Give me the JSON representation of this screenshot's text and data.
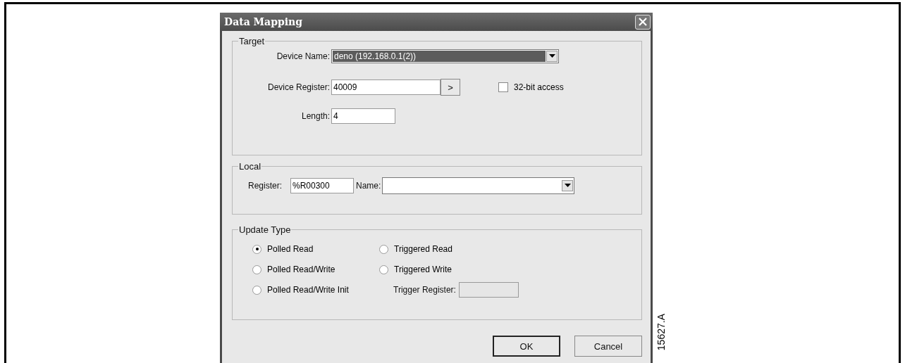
{
  "figure_label": "15627.A",
  "window": {
    "title": "Data Mapping"
  },
  "target": {
    "title": "Target",
    "device_name": {
      "label": "Device Name:",
      "value": "deno (192.168.0.1(2))"
    },
    "device_register": {
      "label": "Device Register:",
      "value": "40009",
      "button": ">"
    },
    "access_32bit": {
      "label": "32-bit access",
      "checked": false
    },
    "length": {
      "label": "Length:",
      "value": "4"
    }
  },
  "local": {
    "title": "Local",
    "register": {
      "label": "Register:",
      "value": "%R00300"
    },
    "name": {
      "label": "Name:"
    }
  },
  "update_type": {
    "title": "Update Type",
    "options": [
      {
        "label": "Polled Read",
        "selected": true
      },
      {
        "label": "Triggered Read",
        "selected": false
      },
      {
        "label": "Polled Read/Write",
        "selected": false
      },
      {
        "label": "Triggered Write",
        "selected": false
      },
      {
        "label": "Polled Read/Write Init",
        "selected": false
      }
    ],
    "trigger_register": {
      "label": "Trigger Register:",
      "disabled": true
    }
  },
  "buttons": [
    {
      "label": "OK",
      "default": true
    },
    {
      "label": "Cancel",
      "default": false
    }
  ]
}
